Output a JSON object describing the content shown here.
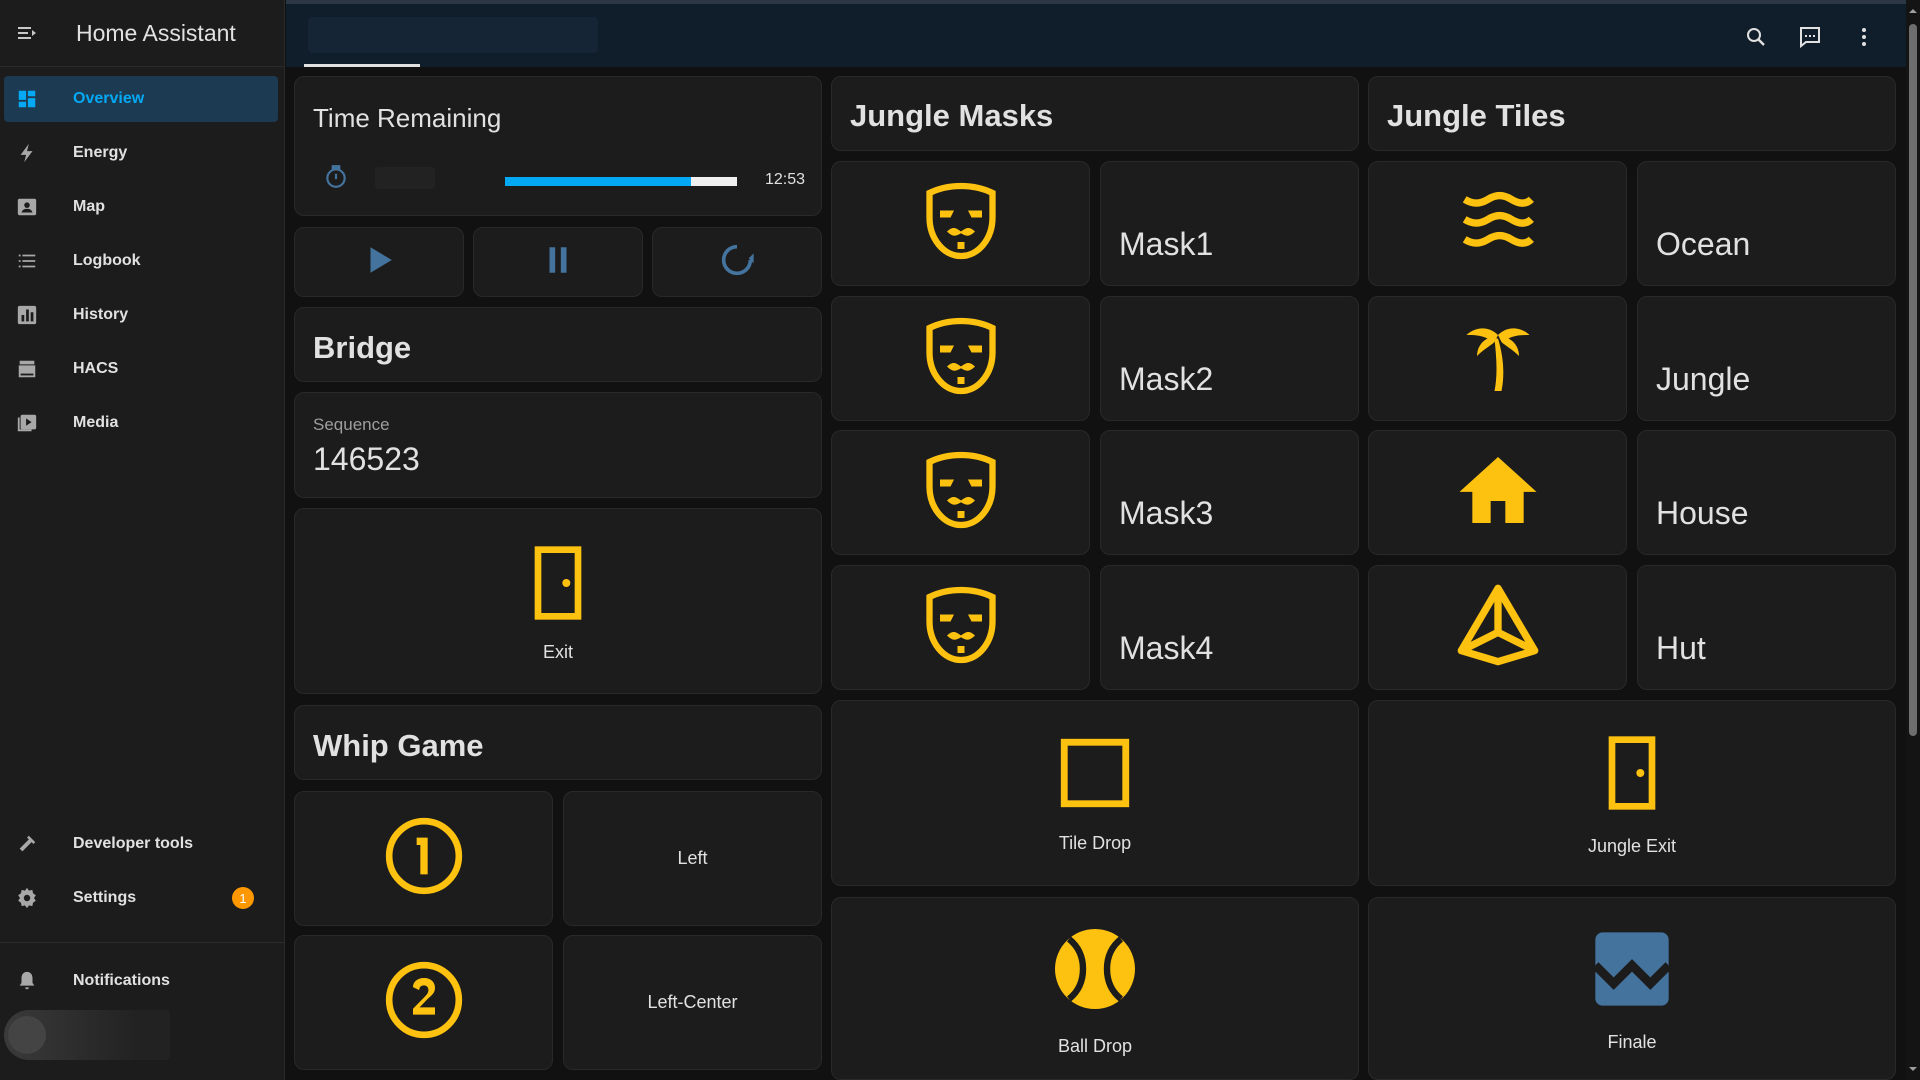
{
  "app": {
    "title": "Home Assistant"
  },
  "sidebar": {
    "items": [
      {
        "label": "Overview",
        "icon": "overview-icon",
        "active": true
      },
      {
        "label": "Energy",
        "icon": "lightning-icon"
      },
      {
        "label": "Map",
        "icon": "map-icon"
      },
      {
        "label": "Logbook",
        "icon": "logbook-icon"
      },
      {
        "label": "History",
        "icon": "history-icon"
      },
      {
        "label": "HACS",
        "icon": "hacs-icon"
      },
      {
        "label": "Media",
        "icon": "media-icon"
      }
    ],
    "bottom": [
      {
        "label": "Developer tools",
        "icon": "hammer-icon"
      },
      {
        "label": "Settings",
        "icon": "gear-icon",
        "badge": "1"
      }
    ],
    "notifications": {
      "label": "Notifications",
      "icon": "bell-icon"
    }
  },
  "timer": {
    "title": "Time Remaining",
    "value": "12:53",
    "progress": 0.8
  },
  "bridge": {
    "title": "Bridge"
  },
  "sequence": {
    "label": "Sequence",
    "value": "146523"
  },
  "exit": {
    "name": "Exit"
  },
  "whip": {
    "title": "Whip Game",
    "items": [
      {
        "label": "Left"
      },
      {
        "label": "Left-Center"
      }
    ]
  },
  "masks": {
    "title": "Jungle Masks",
    "items": [
      {
        "label": "Mask1"
      },
      {
        "label": "Mask2"
      },
      {
        "label": "Mask3"
      },
      {
        "label": "Mask4"
      }
    ]
  },
  "tiles": {
    "title": "Jungle Tiles",
    "items": [
      {
        "label": "Ocean",
        "icon": "waves-icon"
      },
      {
        "label": "Jungle",
        "icon": "palm-tree-icon"
      },
      {
        "label": "House",
        "icon": "home-icon"
      },
      {
        "label": "Hut",
        "icon": "pyramid-icon"
      }
    ]
  },
  "buttons": {
    "tile_drop": "Tile Drop",
    "jungle_exit": "Jungle Exit",
    "ball_drop": "Ball Drop",
    "finale": "Finale"
  },
  "colors": {
    "accent": "#03a9f4",
    "icon_active": "#fdc210",
    "badge": "#ff9800",
    "finale_icon": "#44739e"
  }
}
